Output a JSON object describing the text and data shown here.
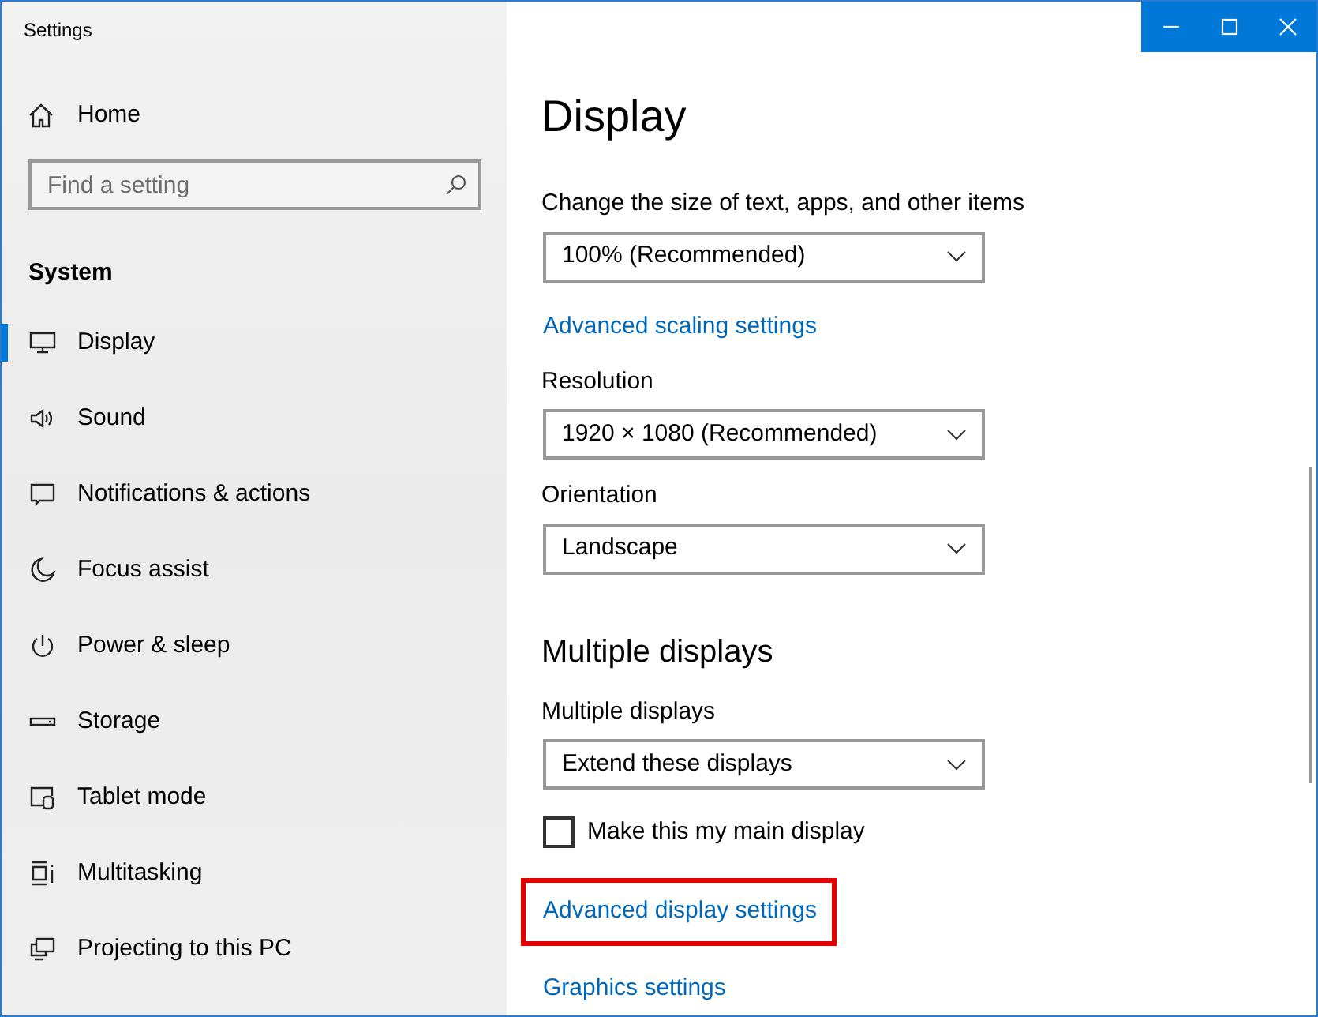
{
  "window": {
    "title": "Settings"
  },
  "sidebar": {
    "home": {
      "label": "Home"
    },
    "search": {
      "placeholder": "Find a setting"
    },
    "section_title": "System",
    "items": [
      {
        "label": "Display",
        "selected": true
      },
      {
        "label": "Sound",
        "selected": false
      },
      {
        "label": "Notifications & actions",
        "selected": false
      },
      {
        "label": "Focus assist",
        "selected": false
      },
      {
        "label": "Power & sleep",
        "selected": false
      },
      {
        "label": "Storage",
        "selected": false
      },
      {
        "label": "Tablet mode",
        "selected": false
      },
      {
        "label": "Multitasking",
        "selected": false
      },
      {
        "label": "Projecting to this PC",
        "selected": false
      }
    ]
  },
  "content": {
    "title": "Display",
    "settings": [
      {
        "kind": "dropdown",
        "label": "Change the size of text, apps, and other items",
        "value": "100% (Recommended)"
      },
      {
        "kind": "link",
        "text": "Advanced scaling settings",
        "highlighted": false
      },
      {
        "kind": "dropdown",
        "label": "Resolution",
        "value": "1920 × 1080 (Recommended)"
      },
      {
        "kind": "dropdown",
        "label": "Orientation",
        "value": "Landscape"
      },
      {
        "kind": "heading",
        "text": "Multiple displays"
      },
      {
        "kind": "dropdown",
        "label": "Multiple displays",
        "value": "Extend these displays"
      },
      {
        "kind": "checkbox",
        "label": "Make this my main display",
        "checked": false
      },
      {
        "kind": "link",
        "text": "Advanced display settings",
        "highlighted": true
      },
      {
        "kind": "link",
        "text": "Graphics settings",
        "highlighted": false
      }
    ]
  }
}
